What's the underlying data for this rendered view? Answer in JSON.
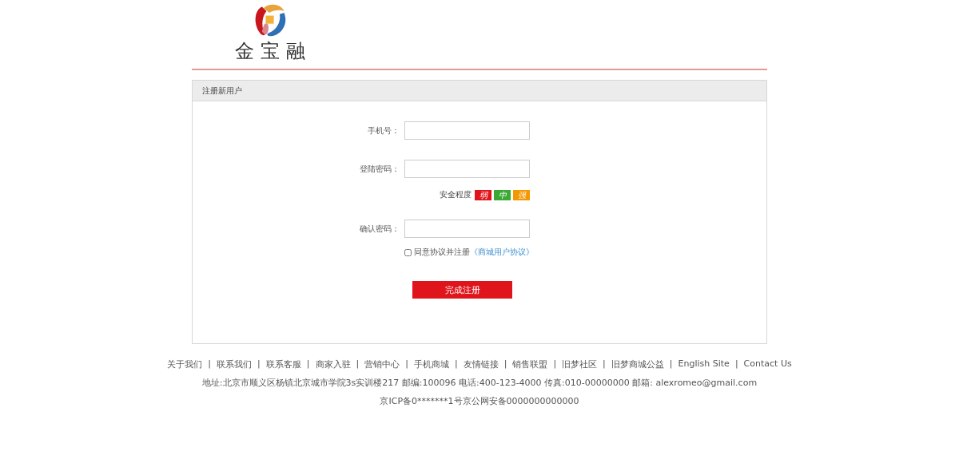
{
  "logo": {
    "text": "金 宝 融"
  },
  "panel": {
    "title": "注册新用户"
  },
  "fields": [
    {
      "kind": "text",
      "label": "手机号："
    },
    {
      "kind": "password",
      "label": "登陆密码："
    },
    {
      "kind": "strength",
      "label": "安全程度",
      "levels": [
        {
          "text": "弱",
          "color": "#e0141b"
        },
        {
          "text": "中",
          "color": "#3aaa35"
        },
        {
          "text": "强",
          "color": "#f39800"
        }
      ]
    },
    {
      "kind": "password",
      "label": "确认密码："
    }
  ],
  "agreement": {
    "checked": false,
    "text": "同意协议并注册",
    "link": "《商城用户协议》"
  },
  "submit": "完成注册",
  "footer": {
    "links": [
      {
        "text": "关于我们",
        "separator": "|"
      },
      {
        "text": "联系我们",
        "separator": "|"
      },
      {
        "text": "联系客服",
        "separator": "|"
      },
      {
        "text": "商家入驻",
        "separator": "|"
      },
      {
        "text": "营销中心",
        "separator": "|"
      },
      {
        "text": "手机商城",
        "separator": "|"
      },
      {
        "text": "友情链接",
        "separator": "|"
      },
      {
        "text": "销售联盟",
        "separator": "|"
      },
      {
        "text": "旧梦社区",
        "separator": "|"
      },
      {
        "text": "旧梦商城公益",
        "separator": "|"
      },
      {
        "text": "English Site",
        "separator": "|"
      },
      {
        "text": "Contact Us"
      }
    ],
    "address": "地址:北京市顺义区杨镇北京城市学院3s实训楼217 邮编:100096 电话:400-123-4000 传真:010-00000000 邮箱: alexromeo@gmail.com",
    "icp": "京ICP备0*******1号京公网安备0000000000000"
  }
}
